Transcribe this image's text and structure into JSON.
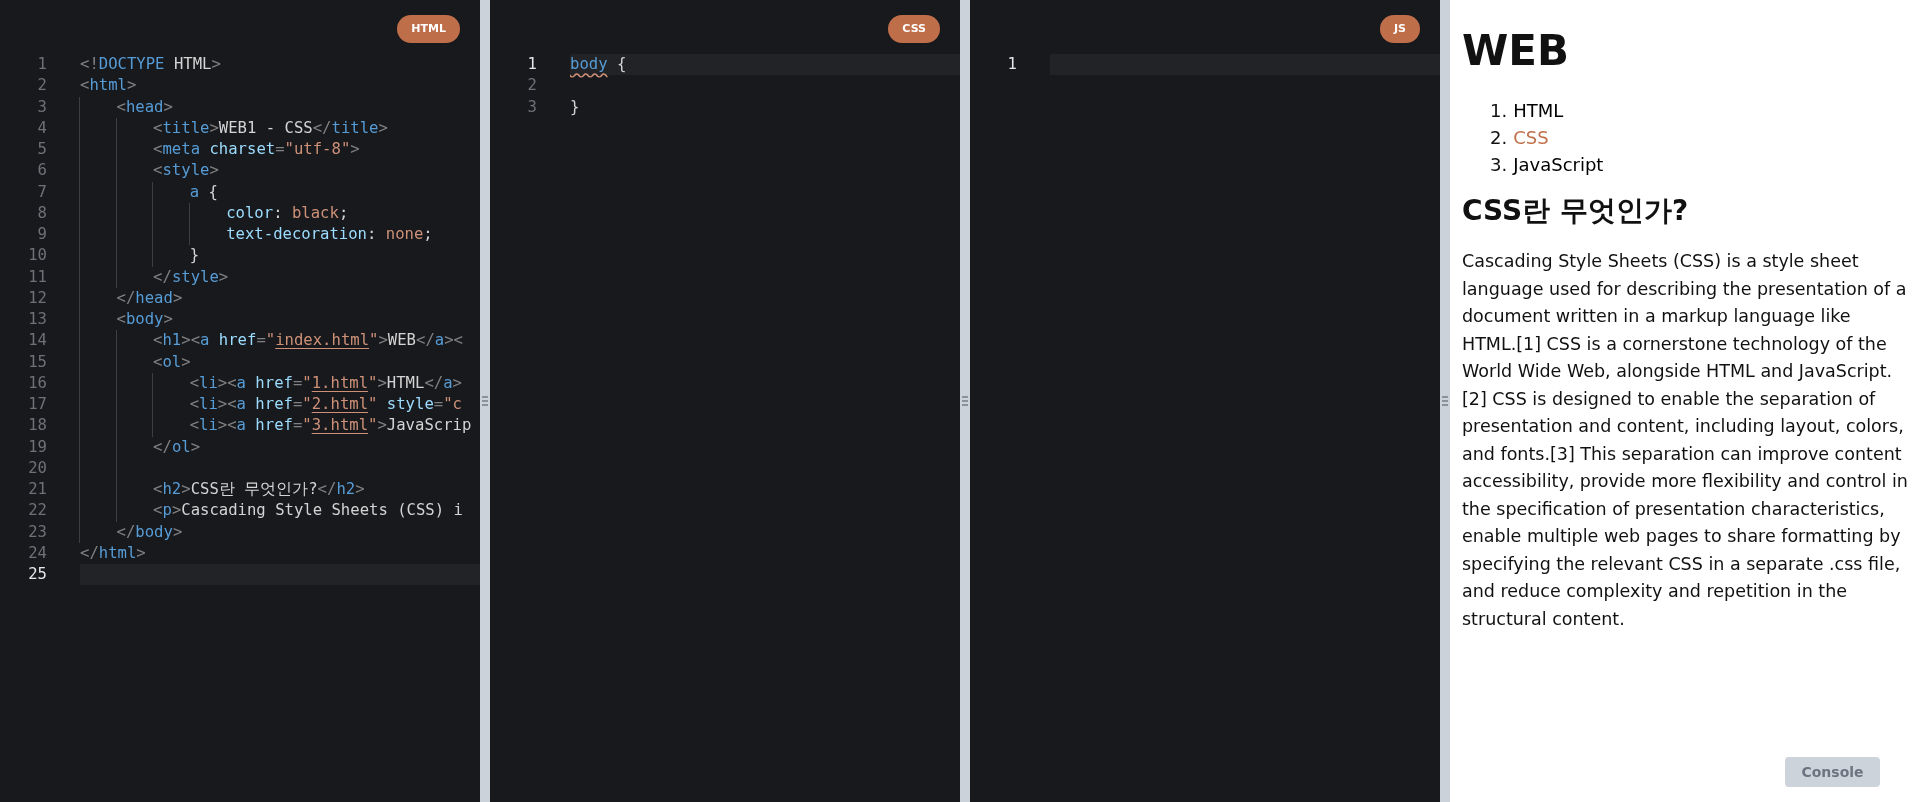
{
  "editors": [
    {
      "badge": "HTML",
      "lines": [
        {
          "number": "1",
          "active": false,
          "tokens": [
            {
              "kind": "punct",
              "text": "<!"
            },
            {
              "kind": "tag",
              "text": "DOCTYPE"
            },
            {
              "kind": "text",
              "text": " HTML"
            },
            {
              "kind": "punct",
              "text": ">"
            }
          ]
        },
        {
          "number": "2",
          "active": false,
          "tokens": [
            {
              "kind": "punct",
              "text": "<"
            },
            {
              "kind": "tag",
              "text": "html"
            },
            {
              "kind": "punct",
              "text": ">"
            }
          ]
        },
        {
          "number": "3",
          "active": false,
          "tokens": [
            {
              "kind": "indent"
            },
            {
              "kind": "punct",
              "text": "<"
            },
            {
              "kind": "tag",
              "text": "head"
            },
            {
              "kind": "punct",
              "text": ">"
            }
          ]
        },
        {
          "number": "4",
          "active": false,
          "tokens": [
            {
              "kind": "indent"
            },
            {
              "kind": "indent"
            },
            {
              "kind": "punct",
              "text": "<"
            },
            {
              "kind": "tag",
              "text": "title"
            },
            {
              "kind": "punct",
              "text": ">"
            },
            {
              "kind": "text",
              "text": "WEB1 - CSS"
            },
            {
              "kind": "punct",
              "text": "</"
            },
            {
              "kind": "tag",
              "text": "title"
            },
            {
              "kind": "punct",
              "text": ">"
            }
          ]
        },
        {
          "number": "5",
          "active": false,
          "tokens": [
            {
              "kind": "indent"
            },
            {
              "kind": "indent"
            },
            {
              "kind": "punct",
              "text": "<"
            },
            {
              "kind": "tag",
              "text": "meta"
            },
            {
              "kind": "attr",
              "text": " charset"
            },
            {
              "kind": "punct",
              "text": "="
            },
            {
              "kind": "str",
              "text": "\"utf-8\""
            },
            {
              "kind": "punct",
              "text": ">"
            }
          ]
        },
        {
          "number": "6",
          "active": false,
          "tokens": [
            {
              "kind": "indent"
            },
            {
              "kind": "indent"
            },
            {
              "kind": "punct",
              "text": "<"
            },
            {
              "kind": "tag",
              "text": "style"
            },
            {
              "kind": "punct",
              "text": ">"
            }
          ]
        },
        {
          "number": "7",
          "active": false,
          "tokens": [
            {
              "kind": "indent"
            },
            {
              "kind": "indent"
            },
            {
              "kind": "indent"
            },
            {
              "kind": "tag",
              "text": "a"
            },
            {
              "kind": "text",
              "text": " {"
            }
          ]
        },
        {
          "number": "8",
          "active": false,
          "tokens": [
            {
              "kind": "indent"
            },
            {
              "kind": "indent"
            },
            {
              "kind": "indent"
            },
            {
              "kind": "indent"
            },
            {
              "kind": "prop",
              "text": "color"
            },
            {
              "kind": "text",
              "text": ": "
            },
            {
              "kind": "value",
              "text": "black"
            },
            {
              "kind": "text",
              "text": ";"
            }
          ]
        },
        {
          "number": "9",
          "active": false,
          "tokens": [
            {
              "kind": "indent"
            },
            {
              "kind": "indent"
            },
            {
              "kind": "indent"
            },
            {
              "kind": "indent"
            },
            {
              "kind": "prop",
              "text": "text-decoration"
            },
            {
              "kind": "text",
              "text": ": "
            },
            {
              "kind": "value",
              "text": "none"
            },
            {
              "kind": "text",
              "text": ";"
            }
          ]
        },
        {
          "number": "10",
          "active": false,
          "tokens": [
            {
              "kind": "indent"
            },
            {
              "kind": "indent"
            },
            {
              "kind": "indent"
            },
            {
              "kind": "text",
              "text": "}"
            }
          ]
        },
        {
          "number": "11",
          "active": false,
          "tokens": [
            {
              "kind": "indent"
            },
            {
              "kind": "indent"
            },
            {
              "kind": "punct",
              "text": "</"
            },
            {
              "kind": "tag",
              "text": "style"
            },
            {
              "kind": "punct",
              "text": ">"
            }
          ]
        },
        {
          "number": "12",
          "active": false,
          "tokens": [
            {
              "kind": "indent"
            },
            {
              "kind": "punct",
              "text": "</"
            },
            {
              "kind": "tag",
              "text": "head"
            },
            {
              "kind": "punct",
              "text": ">"
            }
          ]
        },
        {
          "number": "13",
          "active": false,
          "tokens": [
            {
              "kind": "indent"
            },
            {
              "kind": "punct",
              "text": "<"
            },
            {
              "kind": "tag",
              "text": "body"
            },
            {
              "kind": "punct",
              "text": ">"
            }
          ]
        },
        {
          "number": "14",
          "active": false,
          "tokens": [
            {
              "kind": "indent"
            },
            {
              "kind": "indent"
            },
            {
              "kind": "punct",
              "text": "<"
            },
            {
              "kind": "tag",
              "text": "h1"
            },
            {
              "kind": "punct",
              "text": "><"
            },
            {
              "kind": "tag",
              "text": "a"
            },
            {
              "kind": "attr",
              "text": " href"
            },
            {
              "kind": "punct",
              "text": "="
            },
            {
              "kind": "str",
              "text": "\""
            },
            {
              "kind": "link",
              "text": "index.html"
            },
            {
              "kind": "str",
              "text": "\""
            },
            {
              "kind": "punct",
              "text": ">"
            },
            {
              "kind": "text",
              "text": "WEB"
            },
            {
              "kind": "punct",
              "text": "</"
            },
            {
              "kind": "tag",
              "text": "a"
            },
            {
              "kind": "punct",
              "text": "><"
            }
          ]
        },
        {
          "number": "15",
          "active": false,
          "tokens": [
            {
              "kind": "indent"
            },
            {
              "kind": "indent"
            },
            {
              "kind": "punct",
              "text": "<"
            },
            {
              "kind": "tag",
              "text": "ol"
            },
            {
              "kind": "punct",
              "text": ">"
            }
          ]
        },
        {
          "number": "16",
          "active": false,
          "tokens": [
            {
              "kind": "indent"
            },
            {
              "kind": "indent"
            },
            {
              "kind": "indent"
            },
            {
              "kind": "punct",
              "text": "<"
            },
            {
              "kind": "tag",
              "text": "li"
            },
            {
              "kind": "punct",
              "text": "><"
            },
            {
              "kind": "tag",
              "text": "a"
            },
            {
              "kind": "attr",
              "text": " href"
            },
            {
              "kind": "punct",
              "text": "="
            },
            {
              "kind": "str",
              "text": "\""
            },
            {
              "kind": "link",
              "text": "1.html"
            },
            {
              "kind": "str",
              "text": "\""
            },
            {
              "kind": "punct",
              "text": ">"
            },
            {
              "kind": "text",
              "text": "HTML"
            },
            {
              "kind": "punct",
              "text": "</"
            },
            {
              "kind": "tag",
              "text": "a"
            },
            {
              "kind": "punct",
              "text": ">"
            }
          ]
        },
        {
          "number": "17",
          "active": false,
          "tokens": [
            {
              "kind": "indent"
            },
            {
              "kind": "indent"
            },
            {
              "kind": "indent"
            },
            {
              "kind": "punct",
              "text": "<"
            },
            {
              "kind": "tag",
              "text": "li"
            },
            {
              "kind": "punct",
              "text": "><"
            },
            {
              "kind": "tag",
              "text": "a"
            },
            {
              "kind": "attr",
              "text": " href"
            },
            {
              "kind": "punct",
              "text": "="
            },
            {
              "kind": "str",
              "text": "\""
            },
            {
              "kind": "link",
              "text": "2.html"
            },
            {
              "kind": "str",
              "text": "\""
            },
            {
              "kind": "attr",
              "text": " style"
            },
            {
              "kind": "punct",
              "text": "="
            },
            {
              "kind": "str",
              "text": "\"c"
            }
          ]
        },
        {
          "number": "18",
          "active": false,
          "tokens": [
            {
              "kind": "indent"
            },
            {
              "kind": "indent"
            },
            {
              "kind": "indent"
            },
            {
              "kind": "punct",
              "text": "<"
            },
            {
              "kind": "tag",
              "text": "li"
            },
            {
              "kind": "punct",
              "text": "><"
            },
            {
              "kind": "tag",
              "text": "a"
            },
            {
              "kind": "attr",
              "text": " href"
            },
            {
              "kind": "punct",
              "text": "="
            },
            {
              "kind": "str",
              "text": "\""
            },
            {
              "kind": "link",
              "text": "3.html"
            },
            {
              "kind": "str",
              "text": "\""
            },
            {
              "kind": "punct",
              "text": ">"
            },
            {
              "kind": "text",
              "text": "JavaScrip"
            }
          ]
        },
        {
          "number": "19",
          "active": false,
          "tokens": [
            {
              "kind": "indent"
            },
            {
              "kind": "indent"
            },
            {
              "kind": "punct",
              "text": "</"
            },
            {
              "kind": "tag",
              "text": "ol"
            },
            {
              "kind": "punct",
              "text": ">"
            }
          ]
        },
        {
          "number": "20",
          "active": false,
          "tokens": [
            {
              "kind": "indent"
            },
            {
              "kind": "indent"
            }
          ]
        },
        {
          "number": "21",
          "active": false,
          "tokens": [
            {
              "kind": "indent"
            },
            {
              "kind": "indent"
            },
            {
              "kind": "punct",
              "text": "<"
            },
            {
              "kind": "tag",
              "text": "h2"
            },
            {
              "kind": "punct",
              "text": ">"
            },
            {
              "kind": "text",
              "text": "CSS란 무엇인가?"
            },
            {
              "kind": "punct",
              "text": "</"
            },
            {
              "kind": "tag",
              "text": "h2"
            },
            {
              "kind": "punct",
              "text": ">"
            }
          ]
        },
        {
          "number": "22",
          "active": false,
          "tokens": [
            {
              "kind": "indent"
            },
            {
              "kind": "indent"
            },
            {
              "kind": "punct",
              "text": "<"
            },
            {
              "kind": "tag",
              "text": "p"
            },
            {
              "kind": "punct",
              "text": ">"
            },
            {
              "kind": "text",
              "text": "Cascading Style Sheets (CSS) i"
            }
          ]
        },
        {
          "number": "23",
          "active": false,
          "tokens": [
            {
              "kind": "indent"
            },
            {
              "kind": "punct",
              "text": "</"
            },
            {
              "kind": "tag",
              "text": "body"
            },
            {
              "kind": "punct",
              "text": ">"
            }
          ]
        },
        {
          "number": "24",
          "active": false,
          "tokens": [
            {
              "kind": "punct",
              "text": "</"
            },
            {
              "kind": "tag",
              "text": "html"
            },
            {
              "kind": "punct",
              "text": ">"
            }
          ]
        },
        {
          "number": "25",
          "active": true
        }
      ]
    },
    {
      "badge": "CSS",
      "lines": [
        {
          "number": "1",
          "active": true,
          "tokens": [
            {
              "kind": "flagged",
              "text": "body"
            },
            {
              "kind": "text",
              "text": " {"
            }
          ]
        },
        {
          "number": "2",
          "active": false
        },
        {
          "number": "3",
          "active": false,
          "tokens": [
            {
              "kind": "text",
              "text": "}"
            }
          ]
        }
      ]
    },
    {
      "badge": "JS",
      "lines": [
        {
          "number": "1",
          "active": true
        }
      ]
    }
  ],
  "preview": {
    "heading": "WEB",
    "list": [
      {
        "number": "1.",
        "label": "HTML",
        "color": "#000000"
      },
      {
        "number": "2.",
        "label": "CSS",
        "color": "#c0704a"
      },
      {
        "number": "3.",
        "label": "JavaScript",
        "color": "#000000"
      }
    ],
    "subheading": "CSS란 무엇인가?",
    "paragraph": "Cascading Style Sheets (CSS) is a style sheet language used for describing the presentation of a document written in a markup language like HTML.[1] CSS is a cornerstone technology of the World Wide Web, alongside HTML and JavaScript.[2] CSS is designed to enable the separation of presentation and content, including layout, colors, and fonts.[3] This separation can improve content accessibility, provide more flexibility and control in the specification of presentation characteristics, enable multiple web pages to share formatting by specifying the relevant CSS in a separate .css file, and reduce complexity and repetition in the structural content.",
    "console_button": "Console"
  }
}
